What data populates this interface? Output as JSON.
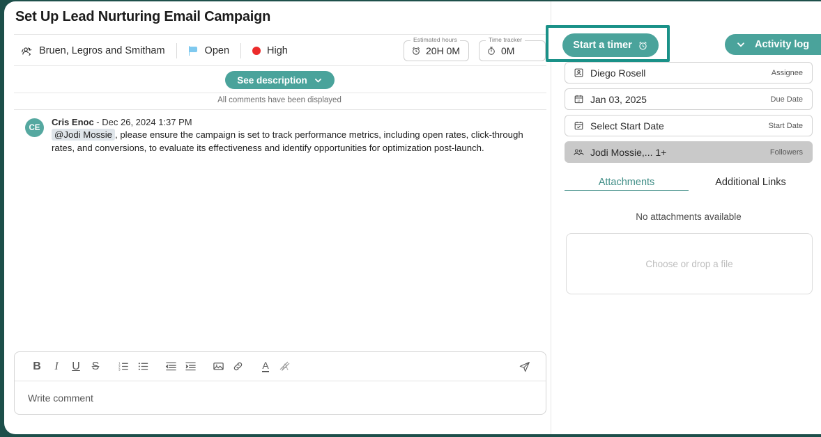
{
  "window": {
    "title": "Set Up Lead Nurturing Email Campaign",
    "expand_icon": "expand-icon",
    "more_icon": "more-options-icon",
    "close_icon": "close-icon"
  },
  "meta": {
    "project": "Bruen, Legros and Smitham",
    "project_icon": "project-rotate-icon",
    "status": "Open",
    "status_icon": "flag-icon",
    "status_color": "#7fc9ef",
    "priority": "High",
    "priority_icon": "priority-dot-icon",
    "priority_color": "#ec2b2b",
    "estimated_hours": {
      "legend": "Estimated hours",
      "value": "20H 0M",
      "icon": "alarm-clock-icon"
    },
    "time_tracker": {
      "legend": "Time tracker",
      "value": "0M",
      "icon": "stopwatch-icon"
    }
  },
  "timer": {
    "label": "Start a timer",
    "icon": "alarm-clock-icon",
    "highlight_color": "#1a9188",
    "button_color": "#4aa39b"
  },
  "activity_log": {
    "label": "Activity log",
    "icon": "chevron-down-icon",
    "color": "#4aa39b"
  },
  "description": {
    "label": "See description",
    "icon": "chevron-down-icon"
  },
  "comments": {
    "notice": "All comments have been displayed",
    "items": [
      {
        "initials": "CE",
        "author": "Cris Enoc",
        "separator": " - ",
        "timestamp": "Dec 26, 2024 1:37 PM",
        "mention": "@Jodi Mossie",
        "text": ", please ensure the campaign is set to track performance metrics, including open rates, click-through rates, and conversions, to evaluate its effectiveness and identify opportunities for optimization post-launch."
      }
    ]
  },
  "editor": {
    "placeholder": "Write comment",
    "value": "",
    "tools": [
      {
        "name": "bold-icon",
        "glyph": "B"
      },
      {
        "name": "italic-icon",
        "glyph": "I"
      },
      {
        "name": "underline-icon",
        "glyph": "U"
      },
      {
        "name": "strikethrough-icon",
        "glyph": "S"
      },
      {
        "name": "ordered-list-icon",
        "glyph": ""
      },
      {
        "name": "bullet-list-icon",
        "glyph": ""
      },
      {
        "name": "outdent-icon",
        "glyph": ""
      },
      {
        "name": "indent-icon",
        "glyph": ""
      },
      {
        "name": "image-icon",
        "glyph": ""
      },
      {
        "name": "link-icon",
        "glyph": ""
      },
      {
        "name": "text-color-icon",
        "glyph": "A"
      },
      {
        "name": "clear-format-icon",
        "glyph": "A"
      }
    ],
    "send_icon": "send-icon"
  },
  "sidebar": {
    "properties": [
      {
        "icon": "user-square-icon",
        "value": "Diego Rosell",
        "label": "Assignee",
        "filled": false
      },
      {
        "icon": "calendar-icon",
        "value": "Jan 03, 2025",
        "label": "Due Date",
        "filled": false
      },
      {
        "icon": "calendar-check-icon",
        "value": "Select Start Date",
        "label": "Start Date",
        "filled": false
      },
      {
        "icon": "users-icon",
        "value": "Jodi Mossie,... 1+",
        "label": "Followers",
        "filled": true
      }
    ],
    "tabs": [
      {
        "label": "Attachments",
        "active": true
      },
      {
        "label": "Additional Links",
        "active": false
      }
    ],
    "empty_state": "No attachments available",
    "dropzone": "Choose or drop a file",
    "accent_color": "#3f8d86"
  }
}
